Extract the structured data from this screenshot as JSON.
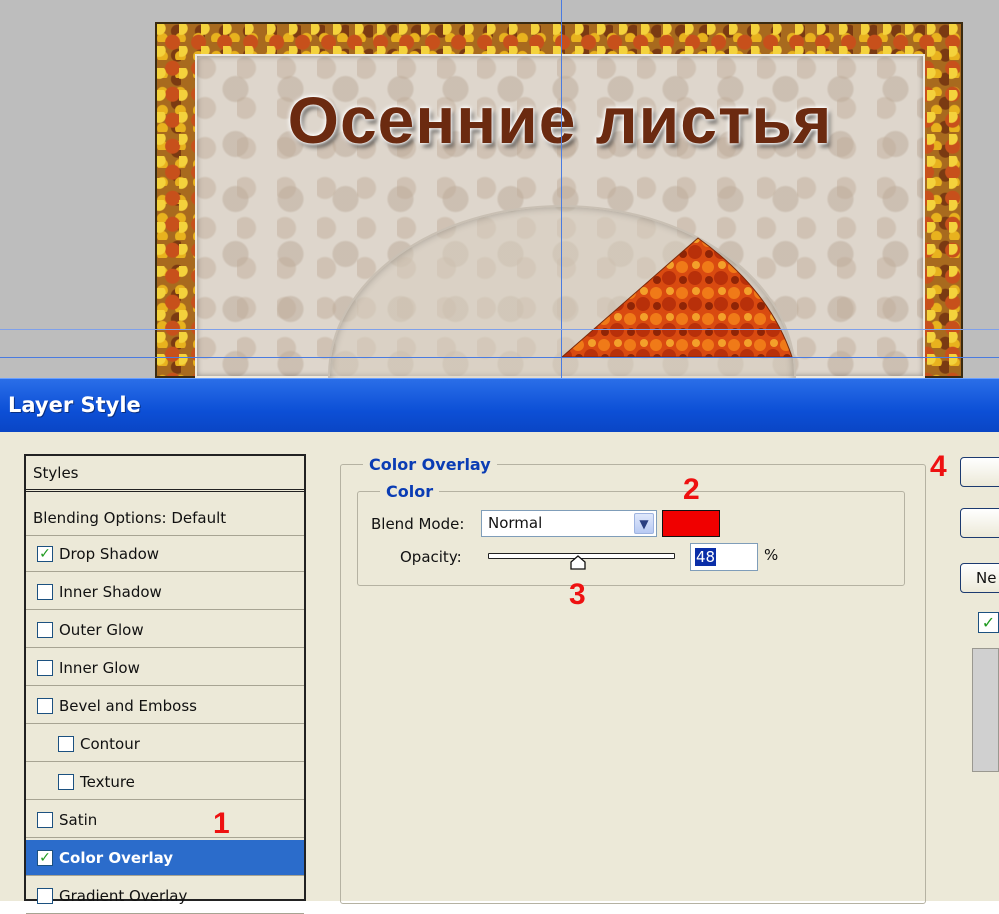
{
  "canvas": {
    "title_text": "Осенние листья"
  },
  "dialog": {
    "title": "Layer Style"
  },
  "styles_panel": {
    "header": "Styles",
    "blending_options": "Blending Options: Default",
    "items": [
      {
        "label": "Drop Shadow",
        "checked": true
      },
      {
        "label": "Inner Shadow",
        "checked": false
      },
      {
        "label": "Outer Glow",
        "checked": false
      },
      {
        "label": "Inner Glow",
        "checked": false
      },
      {
        "label": "Bevel and Emboss",
        "checked": false
      },
      {
        "label": "Contour",
        "checked": false
      },
      {
        "label": "Texture",
        "checked": false
      },
      {
        "label": "Satin",
        "checked": false
      },
      {
        "label": "Color Overlay",
        "checked": true,
        "selected": true
      },
      {
        "label": "Gradient Overlay",
        "checked": false
      }
    ]
  },
  "color_overlay": {
    "section_title": "Color Overlay",
    "group_title": "Color",
    "blend_mode_label": "Blend Mode:",
    "blend_mode_value": "Normal",
    "overlay_color": "#f00000",
    "opacity_label": "Opacity:",
    "opacity_value": "48",
    "opacity_unit": "%",
    "opacity_fraction": 0.48
  },
  "buttons": {
    "new_style_label": "Ne",
    "preview_checked": true
  },
  "annotations": [
    "1",
    "2",
    "3",
    "4"
  ],
  "colors": {
    "title_bar": "#0c4fd6",
    "selection": "#2b6ccb",
    "dialog_bg": "#ece9d8",
    "legend_text": "#0a3cb4",
    "annotation_red": "#ee1111"
  }
}
